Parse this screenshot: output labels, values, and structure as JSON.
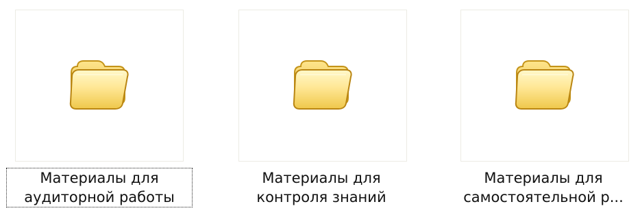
{
  "folders": [
    {
      "line1": "Материалы для",
      "line2": "аудиторной работы",
      "icon": "folder-icon",
      "focused": true
    },
    {
      "line1": "Материалы для",
      "line2": "контроля знаний",
      "icon": "folder-icon",
      "focused": false
    },
    {
      "line1": "Материалы для",
      "line2": "самостоятельной р...",
      "icon": "folder-icon",
      "focused": false
    }
  ],
  "colors": {
    "folder_light": "#fff3b0",
    "folder_mid": "#f5d86c",
    "folder_dark": "#d9a91f",
    "folder_edge": "#b98512"
  }
}
